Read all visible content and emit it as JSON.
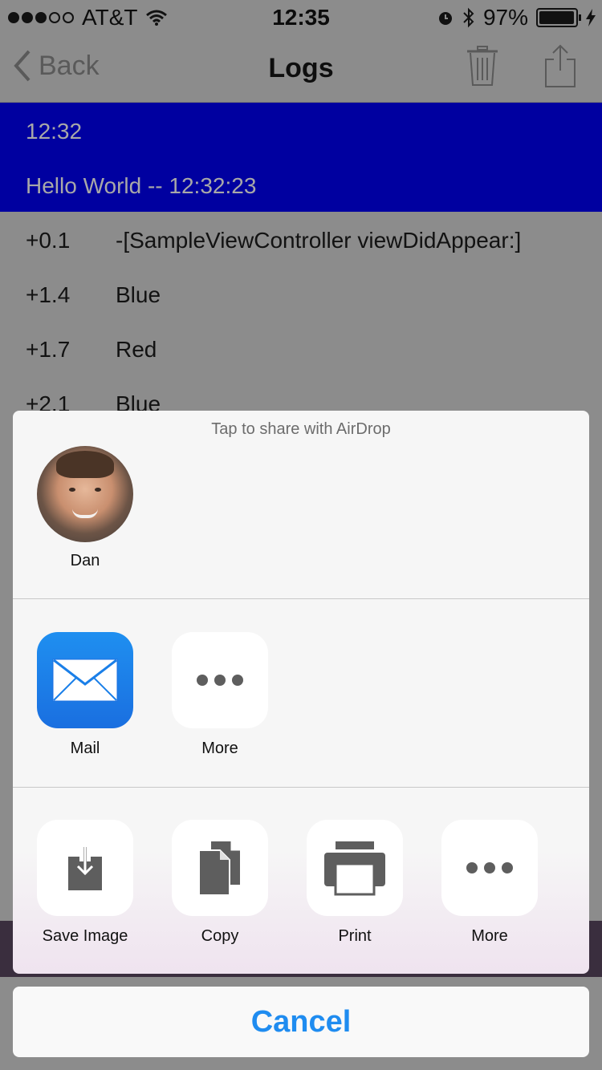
{
  "status_bar": {
    "carrier": "AT&T",
    "signal_bars_filled": 3,
    "signal_bars_total": 5,
    "time": "12:35",
    "battery": "97%",
    "battery_level": 0.97
  },
  "nav": {
    "back_label": "Back",
    "title": "Logs"
  },
  "log_header": {
    "time": "12:32",
    "message": "Hello World -- 12:32:23"
  },
  "log_rows": [
    {
      "time": "+0.1",
      "message": "-[SampleViewController viewDidAppear:]"
    },
    {
      "time": "+1.4",
      "message": "Blue"
    },
    {
      "time": "+1.7",
      "message": "Red"
    },
    {
      "time": "+2.1",
      "message": "Blue"
    }
  ],
  "share_sheet": {
    "airdrop_hint": "Tap to share with AirDrop",
    "airdrop_people": [
      {
        "name": "Dan"
      }
    ],
    "apps": [
      {
        "label": "Mail",
        "icon": "mail-icon"
      },
      {
        "label": "More",
        "icon": "more-icon"
      }
    ],
    "actions": [
      {
        "label": "Save Image",
        "icon": "save-image-icon"
      },
      {
        "label": "Copy",
        "icon": "copy-icon"
      },
      {
        "label": "Print",
        "icon": "print-icon"
      },
      {
        "label": "More",
        "icon": "more-icon"
      }
    ]
  },
  "cancel_label": "Cancel",
  "colors": {
    "dim_background": "#8c8c8c",
    "log_header": "#0000a0",
    "accent_blue": "#1f8cf0",
    "mail_blue": "#1a7fe8",
    "icon_gray": "#5e5e5e"
  }
}
